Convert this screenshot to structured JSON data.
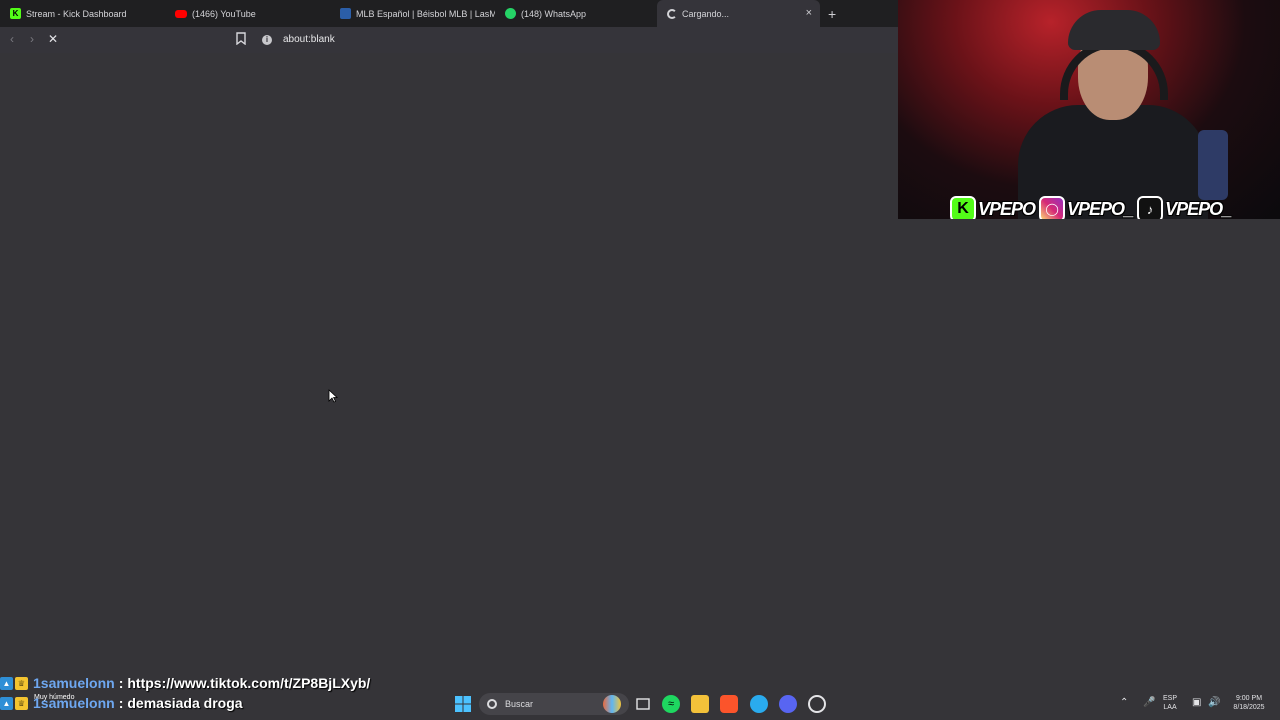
{
  "browser": {
    "tabs": [
      {
        "title": "Stream - Kick Dashboard",
        "icon": "kick-icon",
        "color": "#53fc18"
      },
      {
        "title": "(1466) YouTube",
        "icon": "youtube-icon",
        "color": "#ff0000"
      },
      {
        "title": "MLB Español | Béisbol MLB | LasMay",
        "icon": "mlb-icon",
        "color": "#2b5ea8"
      },
      {
        "title": "(148) WhatsApp",
        "icon": "whatsapp-icon",
        "color": "#25d366"
      },
      {
        "title": "Cargando...",
        "icon": "loading-spinner-icon",
        "active": true
      }
    ],
    "new_tab": "+",
    "close_tab": "×",
    "url": "about:blank"
  },
  "stream_overlay": {
    "socials": [
      {
        "platform": "kick-icon",
        "handle": "VPEPO",
        "color": "#53fc18"
      },
      {
        "platform": "instagram-icon",
        "handle": "VPEPO_",
        "color": "#d6249f"
      },
      {
        "platform": "tiktok-icon",
        "handle": "VPEPO_",
        "color": "#111111"
      }
    ]
  },
  "chat": {
    "messages": [
      {
        "user": "1samuelonn",
        "text": "https://www.tiktok.com/t/ZP8BjLXyb/"
      },
      {
        "user": "1samuelonn",
        "text": "demasiada droga"
      }
    ],
    "separator": ":"
  },
  "taskbar": {
    "weather": "Muy húmedo",
    "search_placeholder": "Buscar",
    "lang_top": "ESP",
    "lang_bottom": "LAA",
    "time": "9:00 PM",
    "date": "8/18/2025"
  }
}
